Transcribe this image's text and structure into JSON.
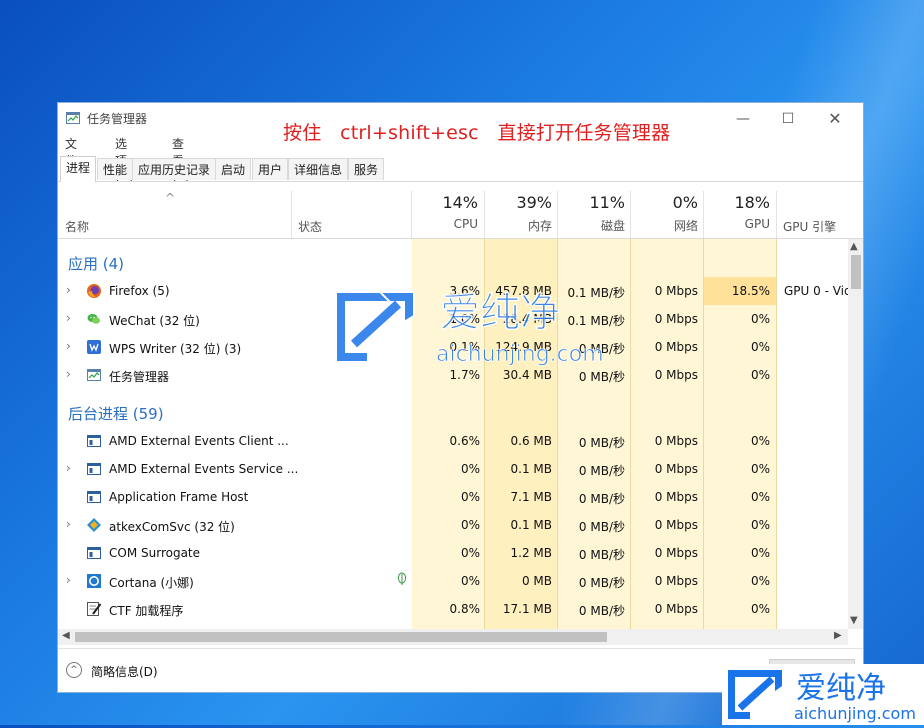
{
  "window": {
    "title": "任务管理器",
    "annotation": "按住   ctrl+shift+esc   直接打开任务管理器",
    "controls": {
      "minimize": "—",
      "maximize": "☐",
      "close": "✕"
    }
  },
  "menu": [
    "文件(F)",
    "选项(O)",
    "查看(V)"
  ],
  "tabs": [
    "进程",
    "性能",
    "应用历史记录",
    "启动",
    "用户",
    "详细信息",
    "服务"
  ],
  "active_tab": "进程",
  "header": {
    "sort_caret": "^",
    "name": "名称",
    "status": "状态",
    "cpu": {
      "pct": "14%",
      "label": "CPU"
    },
    "memory": {
      "pct": "39%",
      "label": "内存"
    },
    "disk": {
      "pct": "11%",
      "label": "磁盘"
    },
    "network": {
      "pct": "0%",
      "label": "网络"
    },
    "gpu": {
      "pct": "18%",
      "label": "GPU"
    },
    "gpu_engine": "GPU 引擎"
  },
  "groups": {
    "apps": "应用 (4)",
    "background": "后台进程 (59)"
  },
  "apps": [
    {
      "name": "Firefox (5)",
      "cpu": "3.6%",
      "mem": "457.8 MB",
      "disk": "0.1 MB/秒",
      "net": "0 Mbps",
      "gpu": "18.5%",
      "engine": "GPU 0 - Vid",
      "icon": "firefox-icon"
    },
    {
      "name": "WeChat (32 位)",
      "cpu": "1.0%",
      "mem": "28.4 MB",
      "disk": "0.1 MB/秒",
      "net": "0 Mbps",
      "gpu": "0%",
      "engine": "",
      "icon": "wechat-icon"
    },
    {
      "name": "WPS Writer (32 位) (3)",
      "cpu": "0.1%",
      "mem": "124.9 MB",
      "disk": "0 MB/秒",
      "net": "0 Mbps",
      "gpu": "0%",
      "engine": "",
      "icon": "wps-writer-icon"
    },
    {
      "name": "任务管理器",
      "cpu": "1.7%",
      "mem": "30.4 MB",
      "disk": "0 MB/秒",
      "net": "0 Mbps",
      "gpu": "0%",
      "engine": "",
      "icon": "task-manager-icon"
    }
  ],
  "background": [
    {
      "name": "AMD External Events Client ...",
      "cpu": "0.6%",
      "mem": "0.6 MB",
      "disk": "0 MB/秒",
      "net": "0 Mbps",
      "gpu": "0%",
      "icon": "service-window-icon"
    },
    {
      "name": "AMD External Events Service ...",
      "cpu": "0%",
      "mem": "0.1 MB",
      "disk": "0 MB/秒",
      "net": "0 Mbps",
      "gpu": "0%",
      "icon": "service-window-icon"
    },
    {
      "name": "Application Frame Host",
      "cpu": "0%",
      "mem": "7.1 MB",
      "disk": "0 MB/秒",
      "net": "0 Mbps",
      "gpu": "0%",
      "icon": "service-window-icon"
    },
    {
      "name": "atkexComSvc (32 位)",
      "cpu": "0%",
      "mem": "0.1 MB",
      "disk": "0 MB/秒",
      "net": "0 Mbps",
      "gpu": "0%",
      "icon": "diamond-app-icon"
    },
    {
      "name": "COM Surrogate",
      "cpu": "0%",
      "mem": "1.2 MB",
      "disk": "0 MB/秒",
      "net": "0 Mbps",
      "gpu": "0%",
      "icon": "service-window-icon"
    },
    {
      "name": "Cortana (小娜)",
      "cpu": "0%",
      "mem": "0 MB",
      "disk": "0 MB/秒",
      "net": "0 Mbps",
      "gpu": "0%",
      "icon": "cortana-icon"
    },
    {
      "name": "CTF 加载程序",
      "cpu": "0.8%",
      "mem": "17.1 MB",
      "disk": "0 MB/秒",
      "net": "0 Mbps",
      "gpu": "0%",
      "icon": "ctf-pen-icon"
    }
  ],
  "footer": {
    "fewer_details": "简略信息(D)"
  },
  "watermark": {
    "brand": "爱纯净",
    "url": "aichunjing.com"
  },
  "colors": {
    "group_title": "#2a6fc0",
    "annotation": "#e02020",
    "gpu_highlight": "#ffe19a",
    "brand_blue": "#1a73e8"
  }
}
